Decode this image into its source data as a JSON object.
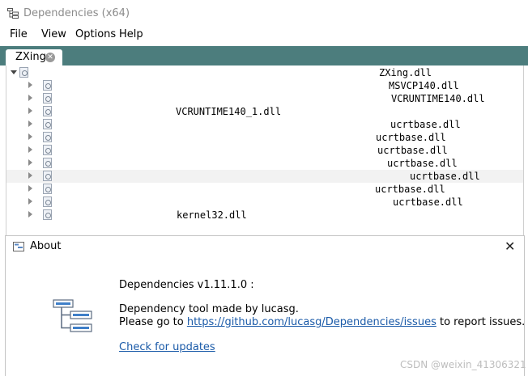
{
  "window": {
    "title": "Dependencies (x64)",
    "icon": "tree-window-icon"
  },
  "menu": {
    "items": [
      "File",
      "View",
      "Options",
      "Help"
    ]
  },
  "tabs": [
    {
      "label": "ZXing",
      "close_icon": "close-circle-icon"
    }
  ],
  "tree": {
    "rows": [
      {
        "text": "ZXing.dll"
      },
      {
        "text": "MSVCP140.dll"
      },
      {
        "text": "VCRUNTIME140.dll"
      },
      {
        "text": "VCRUNTIME140_1.dll"
      },
      {
        "text": "ucrtbase.dll"
      },
      {
        "text": "ucrtbase.dll"
      },
      {
        "text": "ucrtbase.dll"
      },
      {
        "text": "ucrtbase.dll"
      },
      {
        "text": "ucrtbase.dll"
      },
      {
        "text": "ucrtbase.dll"
      },
      {
        "text": "ucrtbase.dll"
      },
      {
        "text": "kernel32.dll"
      }
    ]
  },
  "about": {
    "title": "About",
    "close_label": "✕",
    "version_line": "Dependencies v1.11.1.0 :",
    "description": "Dependency tool made by lucasg.",
    "issues_prefix": "Please go to ",
    "issues_link": "https://github.com/lucasg/Dependencies/issues",
    "issues_suffix": " to report issues.",
    "updates_link": "Check for updates"
  },
  "watermark": "CSDN @weixin_41306321"
}
